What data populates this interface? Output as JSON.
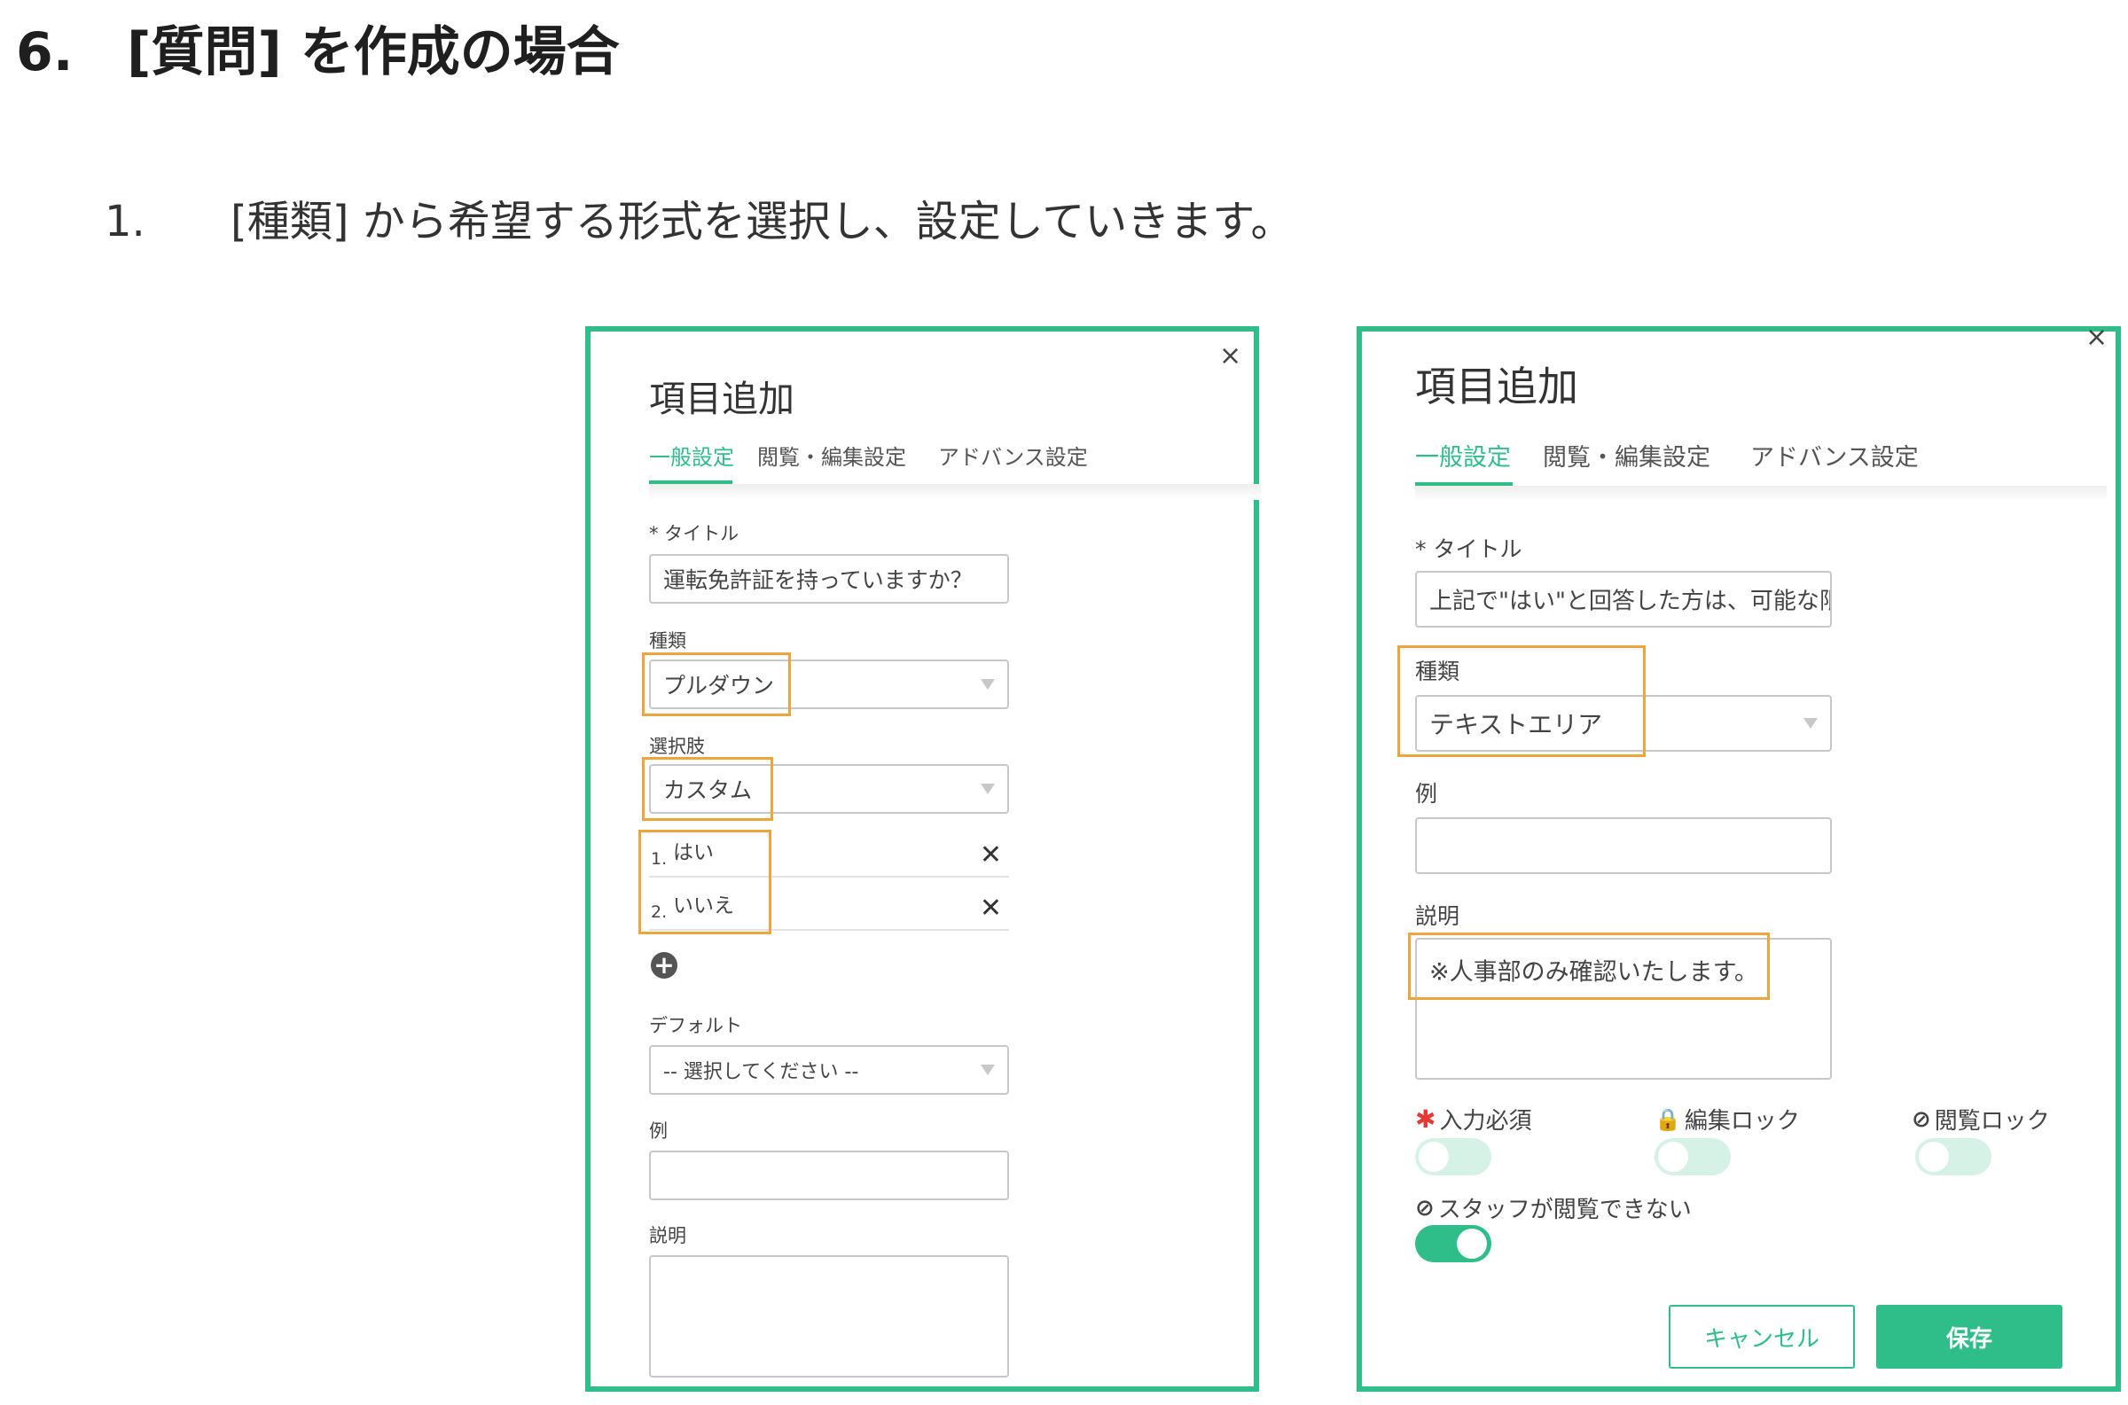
{
  "doc": {
    "heading_number": "6.",
    "heading_text": "[質問] を作成の場合",
    "step_number": "1.",
    "step_text": "[種類] から希望する形式を選択し、設定していきます。"
  },
  "colors": {
    "accent": "#2fbe8a",
    "highlight": "#f0a53c",
    "required": "#e53935"
  },
  "icons": {
    "close": "close-icon",
    "add": "plus-circle-icon",
    "required": "asterisk-icon",
    "lock": "lock-icon",
    "hidden": "eye-off-icon"
  },
  "left_panel": {
    "title": "項目追加",
    "close": "×",
    "tabs": [
      "一般設定",
      "閲覧・編集設定",
      "アドバンス設定"
    ],
    "title_label": "* タイトル",
    "title_value": "運転免許証を持っていますか？",
    "type_label": "種類",
    "type_value": "プルダウン",
    "choices_label": "選択肢",
    "choices_value": "カスタム",
    "options": [
      {
        "num": "1.",
        "text": "はい",
        "remove": "✕"
      },
      {
        "num": "2.",
        "text": "いいえ",
        "remove": "✕"
      }
    ],
    "add_symbol": "+",
    "default_label": "デフォルト",
    "default_value": "-- 選択してください --",
    "example_label": "例",
    "description_label": "説明"
  },
  "right_panel": {
    "title": "項目追加",
    "close": "×",
    "tabs": [
      "一般設定",
      "閲覧・編集設定",
      "アドバンス設定"
    ],
    "title_label": "* タイトル",
    "title_value": "上記で\"はい\"と回答した方は、可能な限",
    "type_label": "種類",
    "type_value": "テキストエリア",
    "example_label": "例",
    "description_label": "説明",
    "description_value": "※人事部のみ確認いたします。",
    "toggles": [
      {
        "symbol": "✱",
        "label": "入力必須",
        "on": false
      },
      {
        "symbol": "🔒",
        "label": "編集ロック",
        "on": false
      },
      {
        "symbol": "⊘",
        "label": "閲覧ロック",
        "on": false
      },
      {
        "symbol": "⊘",
        "label": "スタッフが閲覧できない",
        "on": true
      }
    ],
    "cancel_label": "キャンセル",
    "save_label": "保存"
  }
}
